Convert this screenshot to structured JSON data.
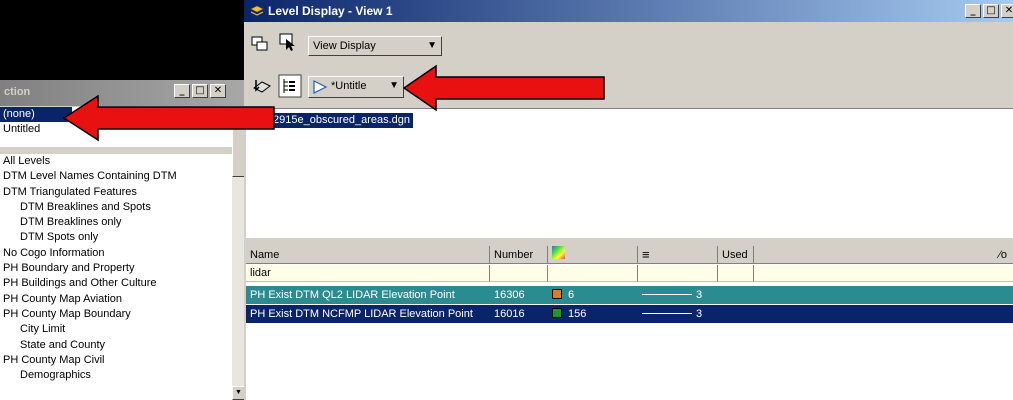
{
  "left_panel": {
    "title": "ction",
    "buttons": [
      "_",
      "□",
      "✕"
    ],
    "top_items": [
      {
        "label": "(none)",
        "selected": true
      },
      {
        "label": "Untitled",
        "selected": false
      }
    ],
    "items": [
      {
        "label": "All Levels",
        "indent": false
      },
      {
        "label": "DTM Level Names Containing DTM",
        "indent": false
      },
      {
        "label": "DTM Triangulated Features",
        "indent": false
      },
      {
        "label": "DTM Breaklines and Spots",
        "indent": true
      },
      {
        "label": "DTM Breaklines only",
        "indent": true
      },
      {
        "label": "DTM Spots only",
        "indent": true
      },
      {
        "label": "No Cogo Information",
        "indent": false
      },
      {
        "label": "PH Boundary and Property",
        "indent": false
      },
      {
        "label": "PH Buildings and Other Culture",
        "indent": false
      },
      {
        "label": "PH County Map Aviation",
        "indent": false
      },
      {
        "label": "PH County Map Boundary",
        "indent": false
      },
      {
        "label": "City Limit",
        "indent": true
      },
      {
        "label": "State and County",
        "indent": true
      },
      {
        "label": "PH County Map Civil",
        "indent": false
      },
      {
        "label": "Demographics",
        "indent": true
      }
    ]
  },
  "main": {
    "title": "Level Display - View 1",
    "title_buttons": [
      "_",
      "□",
      "✕"
    ],
    "view_dropdown": "View Display",
    "filter_dropdown": "*Untitle",
    "file": "2915e_obscured_areas.dgn"
  },
  "table": {
    "headers": [
      "Name",
      "Number",
      "",
      "",
      "Used"
    ],
    "filter_value": "lidar",
    "rows": [
      {
        "name": "PH Exist DTM QL2 LIDAR Elevation Point",
        "number": "16306",
        "color_index": "6",
        "color": "#e07a20",
        "style": "3"
      },
      {
        "name": "PH Exist DTM NCFMP LIDAR Elevation Point",
        "number": "16016",
        "color_index": "156",
        "color": "#1a9a2a",
        "style": "3"
      }
    ]
  },
  "colors": {
    "arrow": "#e81010",
    "selection": "#0a246a",
    "row_highlight": "#2a8c90"
  }
}
